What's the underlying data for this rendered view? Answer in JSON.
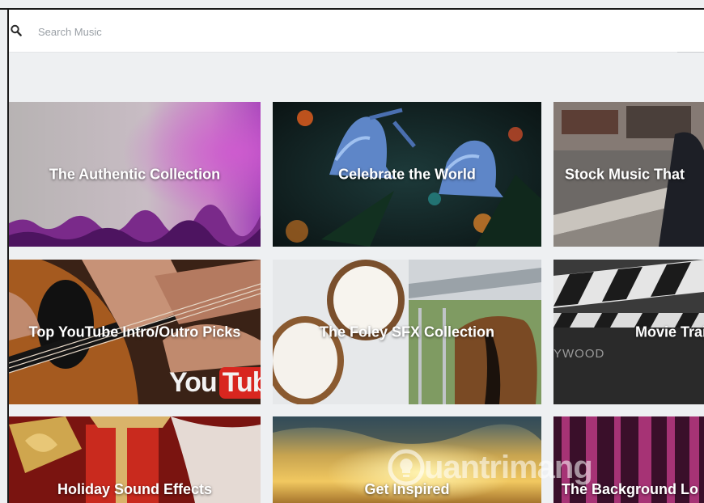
{
  "search": {
    "placeholder": "Search Music",
    "value": ""
  },
  "collections": [
    {
      "label": "The Authentic Collection"
    },
    {
      "label": "Celebrate the World"
    },
    {
      "label": "Stock Music That"
    },
    {
      "label": "Top YouTube Intro/Outro Picks"
    },
    {
      "label": "The Foley SFX Collection"
    },
    {
      "label": "Movie Traile"
    },
    {
      "label": "Holiday Sound Effects"
    },
    {
      "label": "Get Inspired"
    },
    {
      "label": "The Background Lo"
    }
  ],
  "overlay_text": {
    "youtube_left": "You",
    "youtube_right": "Tube",
    "hollywood_fragment": "YWOOD",
    "watermark": "uantrimang"
  },
  "colors": {
    "accent_youtube": "#d8261f",
    "page_background": "#eef0f2"
  }
}
